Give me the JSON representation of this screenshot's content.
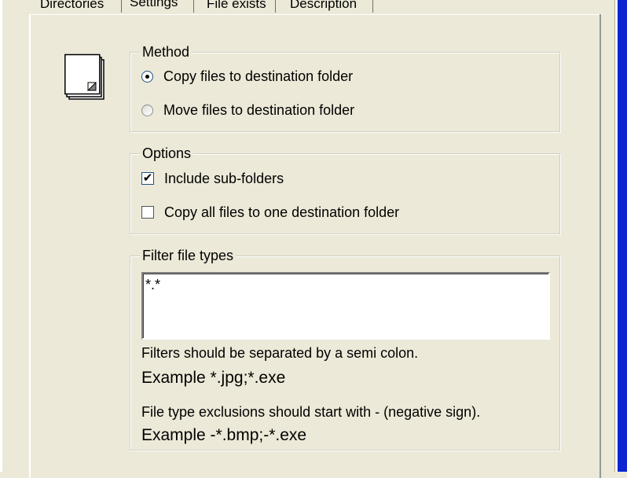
{
  "tabs": [
    {
      "label": "Directories",
      "active": false
    },
    {
      "label": "Settings",
      "active": true
    },
    {
      "label": "File exists",
      "active": false
    },
    {
      "label": "Description",
      "active": false
    }
  ],
  "method": {
    "title": "Method",
    "options": [
      {
        "label": "Copy files to destination folder",
        "selected": true
      },
      {
        "label": "Move files to destination folder",
        "selected": false
      }
    ]
  },
  "options": {
    "title": "Options",
    "items": [
      {
        "label": "Include sub-folders",
        "checked": true
      },
      {
        "label": "Copy all files to one destination folder",
        "checked": false
      }
    ]
  },
  "filter": {
    "title": "Filter file types",
    "value": "*.*",
    "note1": "Filters should be separated by a semi colon.",
    "example1": "Example *.jpg;*.exe",
    "note2": "File type exclusions should start with - (negative sign).",
    "example2": "Example -*.bmp;-*.exe"
  },
  "icon": "document-icon",
  "colors": {
    "window_bg": "#ece9d8",
    "frame_blue": "#0a24d4"
  }
}
